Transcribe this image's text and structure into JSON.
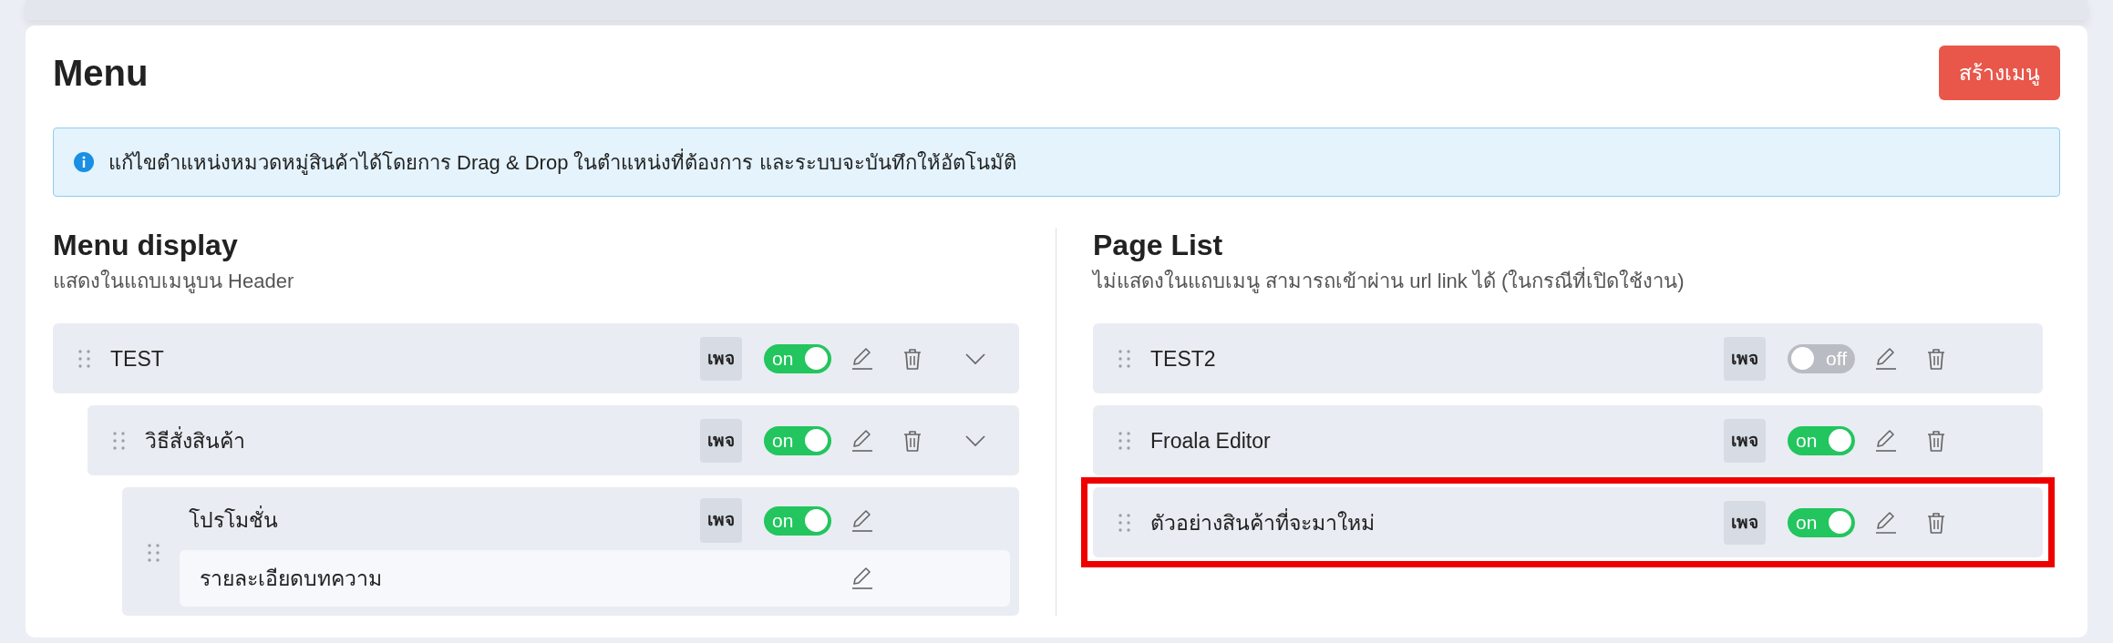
{
  "title": "Menu",
  "create_button": "สร้างเมนู",
  "alert": "แก้ไขตำแหน่งหมวดหมู่สินค้าได้โดยการ Drag & Drop ในตำแหน่งที่ต้องการ และระบบจะบันทึกให้อัตโนมัติ",
  "menu_display": {
    "heading": "Menu display",
    "subtitle": "แสดงในแถบเมนูบน Header",
    "items": [
      {
        "kind": "page",
        "label": "TEST",
        "badge": "เพจ",
        "toggle": {
          "on": true,
          "label": "on"
        },
        "deletable": true,
        "expanded": true,
        "children": [
          {
            "kind": "page",
            "label": "วิธีสั่งสินค้า",
            "badge": "เพจ",
            "toggle": {
              "on": true,
              "label": "on"
            },
            "deletable": true,
            "expanded": true,
            "children": [
              {
                "kind": "page",
                "label": "โปรโมชั่น",
                "badge": "เพจ",
                "toggle": {
                  "on": true,
                  "label": "on"
                },
                "deletable": false,
                "children": [
                  {
                    "kind": "detail",
                    "label": "รายละเอียดบทความ"
                  }
                ]
              }
            ]
          }
        ]
      }
    ]
  },
  "page_list": {
    "heading": "Page List",
    "subtitle": "ไม่แสดงในแถบเมนู สามารถเข้าผ่าน url link ได้ (ในกรณีที่เปิดใช้งาน)",
    "items": [
      {
        "kind": "page",
        "label": "TEST2",
        "badge": "เพจ",
        "toggle": {
          "on": false,
          "label": "off"
        },
        "deletable": true,
        "highlighted": false
      },
      {
        "kind": "page",
        "label": "Froala Editor",
        "badge": "เพจ",
        "toggle": {
          "on": true,
          "label": "on"
        },
        "deletable": true,
        "highlighted": false
      },
      {
        "kind": "page",
        "label": "ตัวอย่างสินค้าที่จะมาใหม่",
        "badge": "เพจ",
        "toggle": {
          "on": true,
          "label": "on"
        },
        "deletable": true,
        "highlighted": true
      }
    ]
  }
}
